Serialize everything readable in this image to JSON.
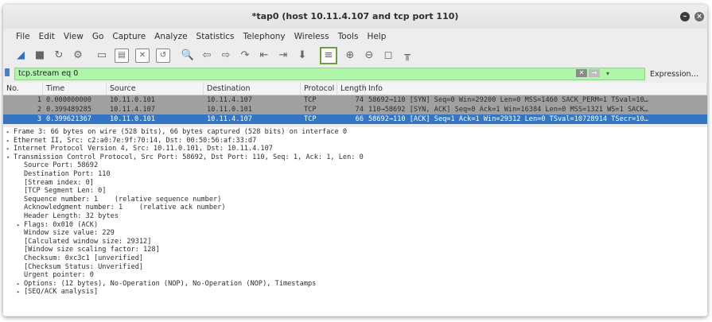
{
  "window": {
    "title": "*tap0 (host 10.11.4.107  and tcp port 110)",
    "min_glyph": "–",
    "close_glyph": "×"
  },
  "menu": [
    "File",
    "Edit",
    "View",
    "Go",
    "Capture",
    "Analyze",
    "Statistics",
    "Telephony",
    "Wireless",
    "Tools",
    "Help"
  ],
  "toolbar": {
    "icons": [
      {
        "name": "start-capture-icon",
        "glyph": "◢",
        "cls": "blue"
      },
      {
        "name": "stop-capture-icon",
        "glyph": "■",
        "cls": ""
      },
      {
        "name": "restart-capture-icon",
        "glyph": "↻",
        "cls": ""
      },
      {
        "name": "capture-options-icon",
        "glyph": "⚙",
        "cls": ""
      },
      {
        "name": "open-file-icon",
        "glyph": "▭",
        "cls": ""
      },
      {
        "name": "save-file-icon",
        "glyph": "▤",
        "cls": "boxed"
      },
      {
        "name": "close-file-icon",
        "glyph": "✕",
        "cls": "boxed"
      },
      {
        "name": "reload-file-icon",
        "glyph": "↺",
        "cls": "boxed"
      },
      {
        "name": "find-packet-icon",
        "glyph": "🔍",
        "cls": "blue"
      },
      {
        "name": "go-back-icon",
        "glyph": "⇦",
        "cls": ""
      },
      {
        "name": "go-forward-icon",
        "glyph": "⇨",
        "cls": ""
      },
      {
        "name": "go-to-packet-icon",
        "glyph": "↷",
        "cls": ""
      },
      {
        "name": "first-packet-icon",
        "glyph": "⇤",
        "cls": ""
      },
      {
        "name": "last-packet-icon",
        "glyph": "⇥",
        "cls": ""
      },
      {
        "name": "autoscroll-icon",
        "glyph": "⬇",
        "cls": ""
      },
      {
        "name": "colorize-icon",
        "glyph": "≡",
        "cls": "zoom"
      },
      {
        "name": "zoom-in-icon",
        "glyph": "⊕",
        "cls": ""
      },
      {
        "name": "zoom-out-icon",
        "glyph": "⊖",
        "cls": ""
      },
      {
        "name": "zoom-normal-icon",
        "glyph": "◻",
        "cls": ""
      },
      {
        "name": "resize-columns-icon",
        "glyph": "╥",
        "cls": ""
      }
    ]
  },
  "filter": {
    "value": "tcp.stream eq 0",
    "expression_label": "Expression…",
    "dropdown_glyph": "▾",
    "clear_glyph": "✕",
    "apply_glyph": "→"
  },
  "packet_list": {
    "columns": [
      "No.",
      "Time",
      "Source",
      "Destination",
      "Protocol",
      "Length",
      "Info"
    ],
    "rows": [
      {
        "no": "1",
        "time": "0.000000000",
        "src": "10.11.0.101",
        "dst": "10.11.4.107",
        "proto": "TCP",
        "len": "74",
        "info": "58692→110 [SYN] Seq=0 Win=29200 Len=0 MSS=1460 SACK_PERM=1 TSval=10…",
        "state": "gray"
      },
      {
        "no": "2",
        "time": "0.399489285",
        "src": "10.11.4.107",
        "dst": "10.11.0.101",
        "proto": "TCP",
        "len": "74",
        "info": "110→58692 [SYN, ACK] Seq=0 Ack=1 Win=16384 Len=0 MSS=1321 WS=1 SACK…",
        "state": "gray"
      },
      {
        "no": "3",
        "time": "0.399621367",
        "src": "10.11.0.101",
        "dst": "10.11.4.107",
        "proto": "TCP",
        "len": "66",
        "info": "58692→110 [ACK] Seq=1 Ack=1 Win=29312 Len=0 TSval=10728914 TSecr=10…",
        "state": "sel"
      }
    ]
  },
  "details": [
    {
      "indent": 0,
      "tri": "▸",
      "text": "Frame 3: 66 bytes on wire (528 bits), 66 bytes captured (528 bits) on interface 0"
    },
    {
      "indent": 0,
      "tri": "▸",
      "text": "Ethernet II, Src: c2:a0:7e:9f:70:14, Dst: 00:50:56:af:33:d7"
    },
    {
      "indent": 0,
      "tri": "▸",
      "text": "Internet Protocol Version 4, Src: 10.11.0.101, Dst: 10.11.4.107"
    },
    {
      "indent": 0,
      "tri": "▾",
      "text": "Transmission Control Protocol, Src Port: 58692, Dst Port: 110, Seq: 1, Ack: 1, Len: 0"
    },
    {
      "indent": 1,
      "tri": "",
      "text": "Source Port: 58692"
    },
    {
      "indent": 1,
      "tri": "",
      "text": "Destination Port: 110"
    },
    {
      "indent": 1,
      "tri": "",
      "text": "[Stream index: 0]"
    },
    {
      "indent": 1,
      "tri": "",
      "text": "[TCP Segment Len: 0]"
    },
    {
      "indent": 1,
      "tri": "",
      "text": "Sequence number: 1    (relative sequence number)"
    },
    {
      "indent": 1,
      "tri": "",
      "text": "Acknowledgment number: 1    (relative ack number)"
    },
    {
      "indent": 1,
      "tri": "",
      "text": "Header Length: 32 bytes"
    },
    {
      "indent": 1,
      "tri": "▸",
      "text": "Flags: 0x010 (ACK)"
    },
    {
      "indent": 1,
      "tri": "",
      "text": "Window size value: 229"
    },
    {
      "indent": 1,
      "tri": "",
      "text": "[Calculated window size: 29312]"
    },
    {
      "indent": 1,
      "tri": "",
      "text": "[Window size scaling factor: 128]"
    },
    {
      "indent": 1,
      "tri": "",
      "text": "Checksum: 0xc3c1 [unverified]"
    },
    {
      "indent": 1,
      "tri": "",
      "text": "[Checksum Status: Unverified]"
    },
    {
      "indent": 1,
      "tri": "",
      "text": "Urgent pointer: 0"
    },
    {
      "indent": 1,
      "tri": "▸",
      "text": "Options: (12 bytes), No-Operation (NOP), No-Operation (NOP), Timestamps"
    },
    {
      "indent": 1,
      "tri": "▸",
      "text": "[SEQ/ACK analysis]"
    }
  ]
}
